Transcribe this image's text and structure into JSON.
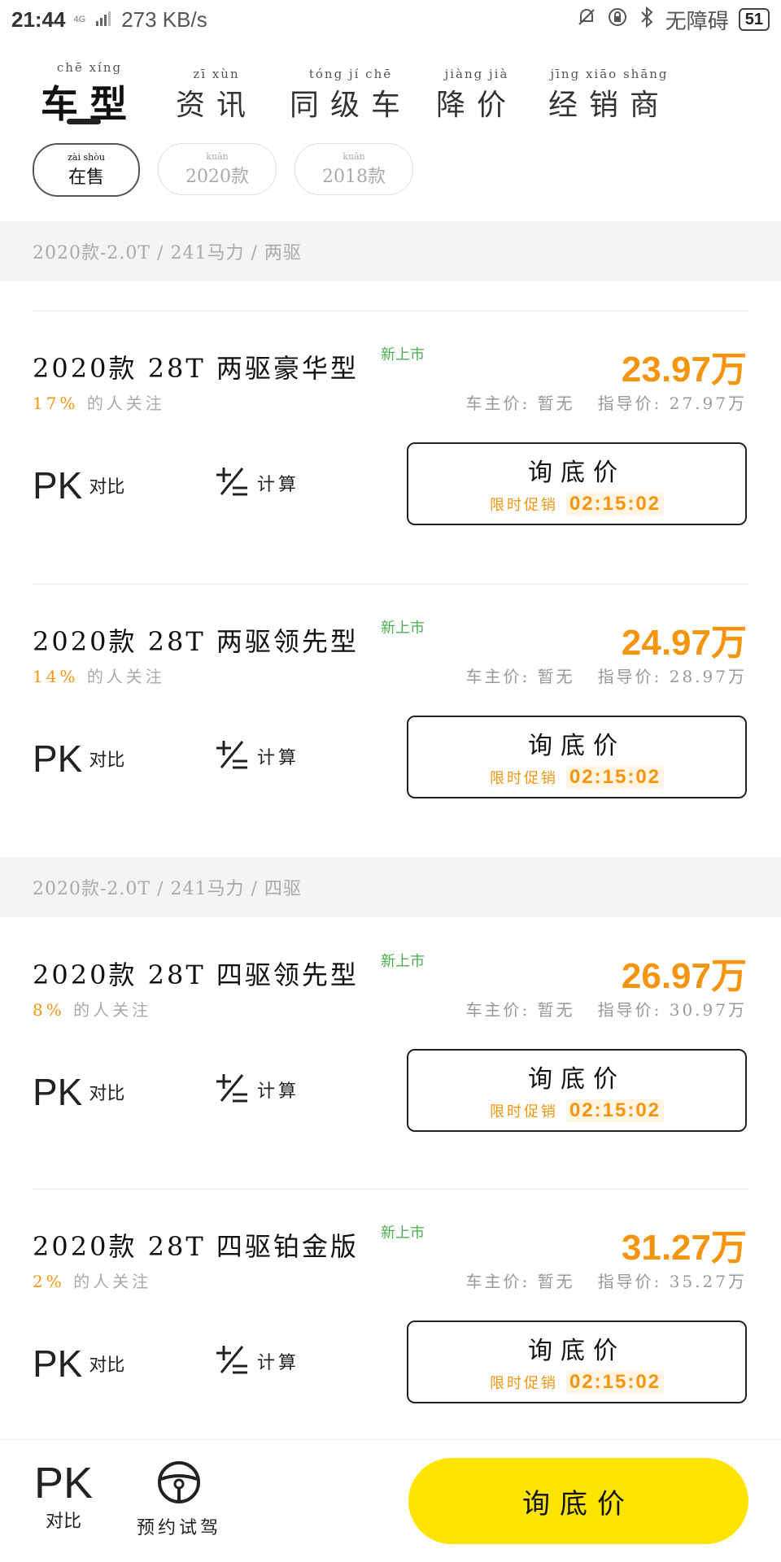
{
  "status_bar": {
    "time": "21:44",
    "network": "4G",
    "speed": "273 KB/s",
    "accessibility": "无障碍",
    "battery": "51"
  },
  "tabs": [
    {
      "pinyin": "chē xíng",
      "label": "车型",
      "active": true
    },
    {
      "pinyin": "zī xùn",
      "label": "资讯",
      "active": false
    },
    {
      "pinyin": "tóng jí chē",
      "label": "同级车",
      "active": false
    },
    {
      "pinyin": "jiàng jià",
      "label": "降价",
      "active": false
    },
    {
      "pinyin": "jīng xiāo shāng",
      "label": "经销商",
      "active": false
    }
  ],
  "filters": [
    {
      "pinyin": "zài shòu",
      "label": "在售",
      "active": true
    },
    {
      "pinyin": "kuǎn",
      "label": "2020款",
      "active": false
    },
    {
      "pinyin": "kuǎn",
      "label": "2018款",
      "active": false
    }
  ],
  "sections": [
    {
      "header": "2020款-2.0T / 241马力 / 两驱",
      "cards": [
        {
          "title": "2020款 28T 两驱豪华型",
          "badge": "新上市",
          "price": "23.97万",
          "attention_pct": "17%",
          "attention_text": "的人关注",
          "owner_price": "车主价: 暂无",
          "guide_price": "指导价: 27.97万",
          "pk_label": "PK",
          "pk_sub": "对比",
          "calc_label": "计算",
          "inquiry_label": "询底价",
          "promo_label": "限时促销",
          "timer": "02:15:02"
        },
        {
          "title": "2020款 28T 两驱领先型",
          "badge": "新上市",
          "price": "24.97万",
          "attention_pct": "14%",
          "attention_text": "的人关注",
          "owner_price": "车主价: 暂无",
          "guide_price": "指导价: 28.97万",
          "pk_label": "PK",
          "pk_sub": "对比",
          "calc_label": "计算",
          "inquiry_label": "询底价",
          "promo_label": "限时促销",
          "timer": "02:15:02"
        }
      ]
    },
    {
      "header": "2020款-2.0T / 241马力 / 四驱",
      "cards": [
        {
          "title": "2020款 28T 四驱领先型",
          "badge": "新上市",
          "price": "26.97万",
          "attention_pct": "8%",
          "attention_text": "的人关注",
          "owner_price": "车主价: 暂无",
          "guide_price": "指导价: 30.97万",
          "pk_label": "PK",
          "pk_sub": "对比",
          "calc_label": "计算",
          "inquiry_label": "询底价",
          "promo_label": "限时促销",
          "timer": "02:15:02"
        },
        {
          "title": "2020款 28T 四驱铂金版",
          "badge": "新上市",
          "price": "31.27万",
          "attention_pct": "2%",
          "attention_text": "的人关注",
          "owner_price": "车主价: 暂无",
          "guide_price": "指导价: 35.27万",
          "pk_label": "PK",
          "pk_sub": "对比",
          "calc_label": "计算",
          "inquiry_label": "询底价",
          "promo_label": "限时促销",
          "timer": "02:15:02"
        }
      ]
    }
  ],
  "bottom_bar": {
    "pk_label": "PK",
    "pk_sub": "对比",
    "test_drive": "预约试驾",
    "inquiry": "询底价"
  },
  "colors": {
    "price": "#f5950f",
    "badge": "#4caf50",
    "primary_button": "#ffe400"
  }
}
